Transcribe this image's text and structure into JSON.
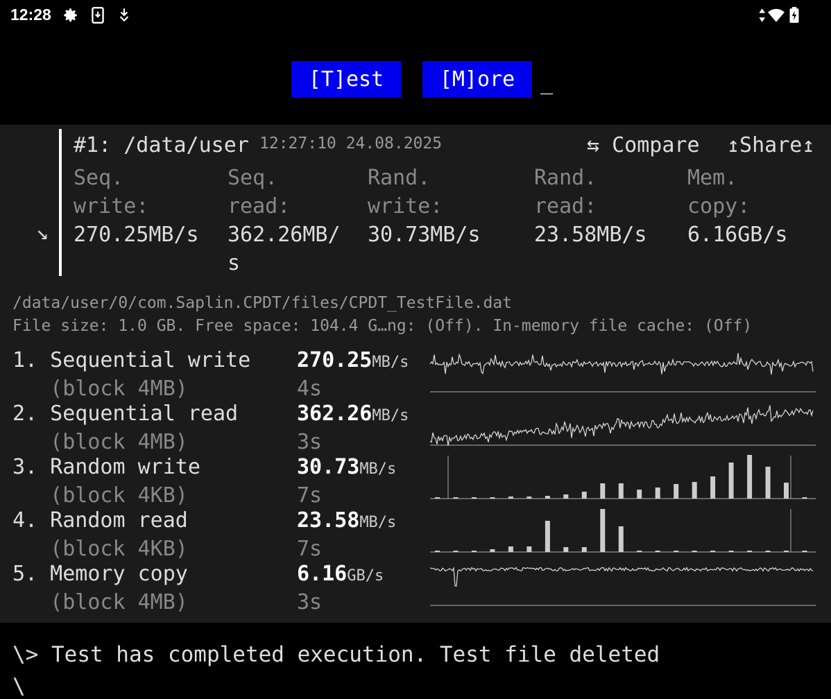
{
  "status_bar": {
    "time": "12:28"
  },
  "toolbar": {
    "test_label": "[T]est",
    "more_label": "[M]ore",
    "cursor": "_"
  },
  "result": {
    "title": "#1: /data/user",
    "timestamp": "12:27:10 24.08.2025",
    "compare_label": "⇆ Compare",
    "share_label": "↥Share↥",
    "expand_glyph": "↘",
    "metrics": [
      {
        "label1": "Seq.",
        "label2": "write:",
        "value1": "270.25MB/s",
        "value2": ""
      },
      {
        "label1": "Seq.",
        "label2": "read:",
        "value1": "362.26MB/",
        "value2": "s"
      },
      {
        "label1": "Rand.",
        "label2": "write:",
        "value1": "30.73MB/s",
        "value2": ""
      },
      {
        "label1": "Rand.",
        "label2": "read:",
        "value1": "23.58MB/s",
        "value2": ""
      },
      {
        "label1": "Mem.",
        "label2": "copy:",
        "value1": "6.16GB/s",
        "value2": ""
      }
    ]
  },
  "file": {
    "path": "/data/user/0/com.Saplin.CPDT/files/CPDT_TestFile.dat",
    "info": "File size: 1.0 GB. Free space: 104.4 G…ng: (Off). In-memory file cache: (Off)"
  },
  "tests": [
    {
      "name": "1. Sequential write",
      "block": "   (block 4MB)",
      "value": "270.25",
      "unit": "MB/s",
      "time": "4s"
    },
    {
      "name": "2. Sequential read",
      "block": "   (block 4MB)",
      "value": "362.26",
      "unit": "MB/s",
      "time": "3s"
    },
    {
      "name": "3. Random write",
      "block": "   (block 4KB)",
      "value": "30.73",
      "unit": "MB/s",
      "time": "7s"
    },
    {
      "name": "4. Random read",
      "block": "   (block 4KB)",
      "value": "23.58",
      "unit": "MB/s",
      "time": "7s"
    },
    {
      "name": "5. Memory copy",
      "block": "   (block 4MB)",
      "value": "6.16",
      "unit": "GB/s",
      "time": "3s"
    }
  ],
  "console": {
    "line": "\\> Test has completed execution. Test file deleted",
    "prompt": "\\"
  },
  "colors": {
    "button_bg": "#0000ee",
    "panel_bg": "#1b1b1b"
  }
}
